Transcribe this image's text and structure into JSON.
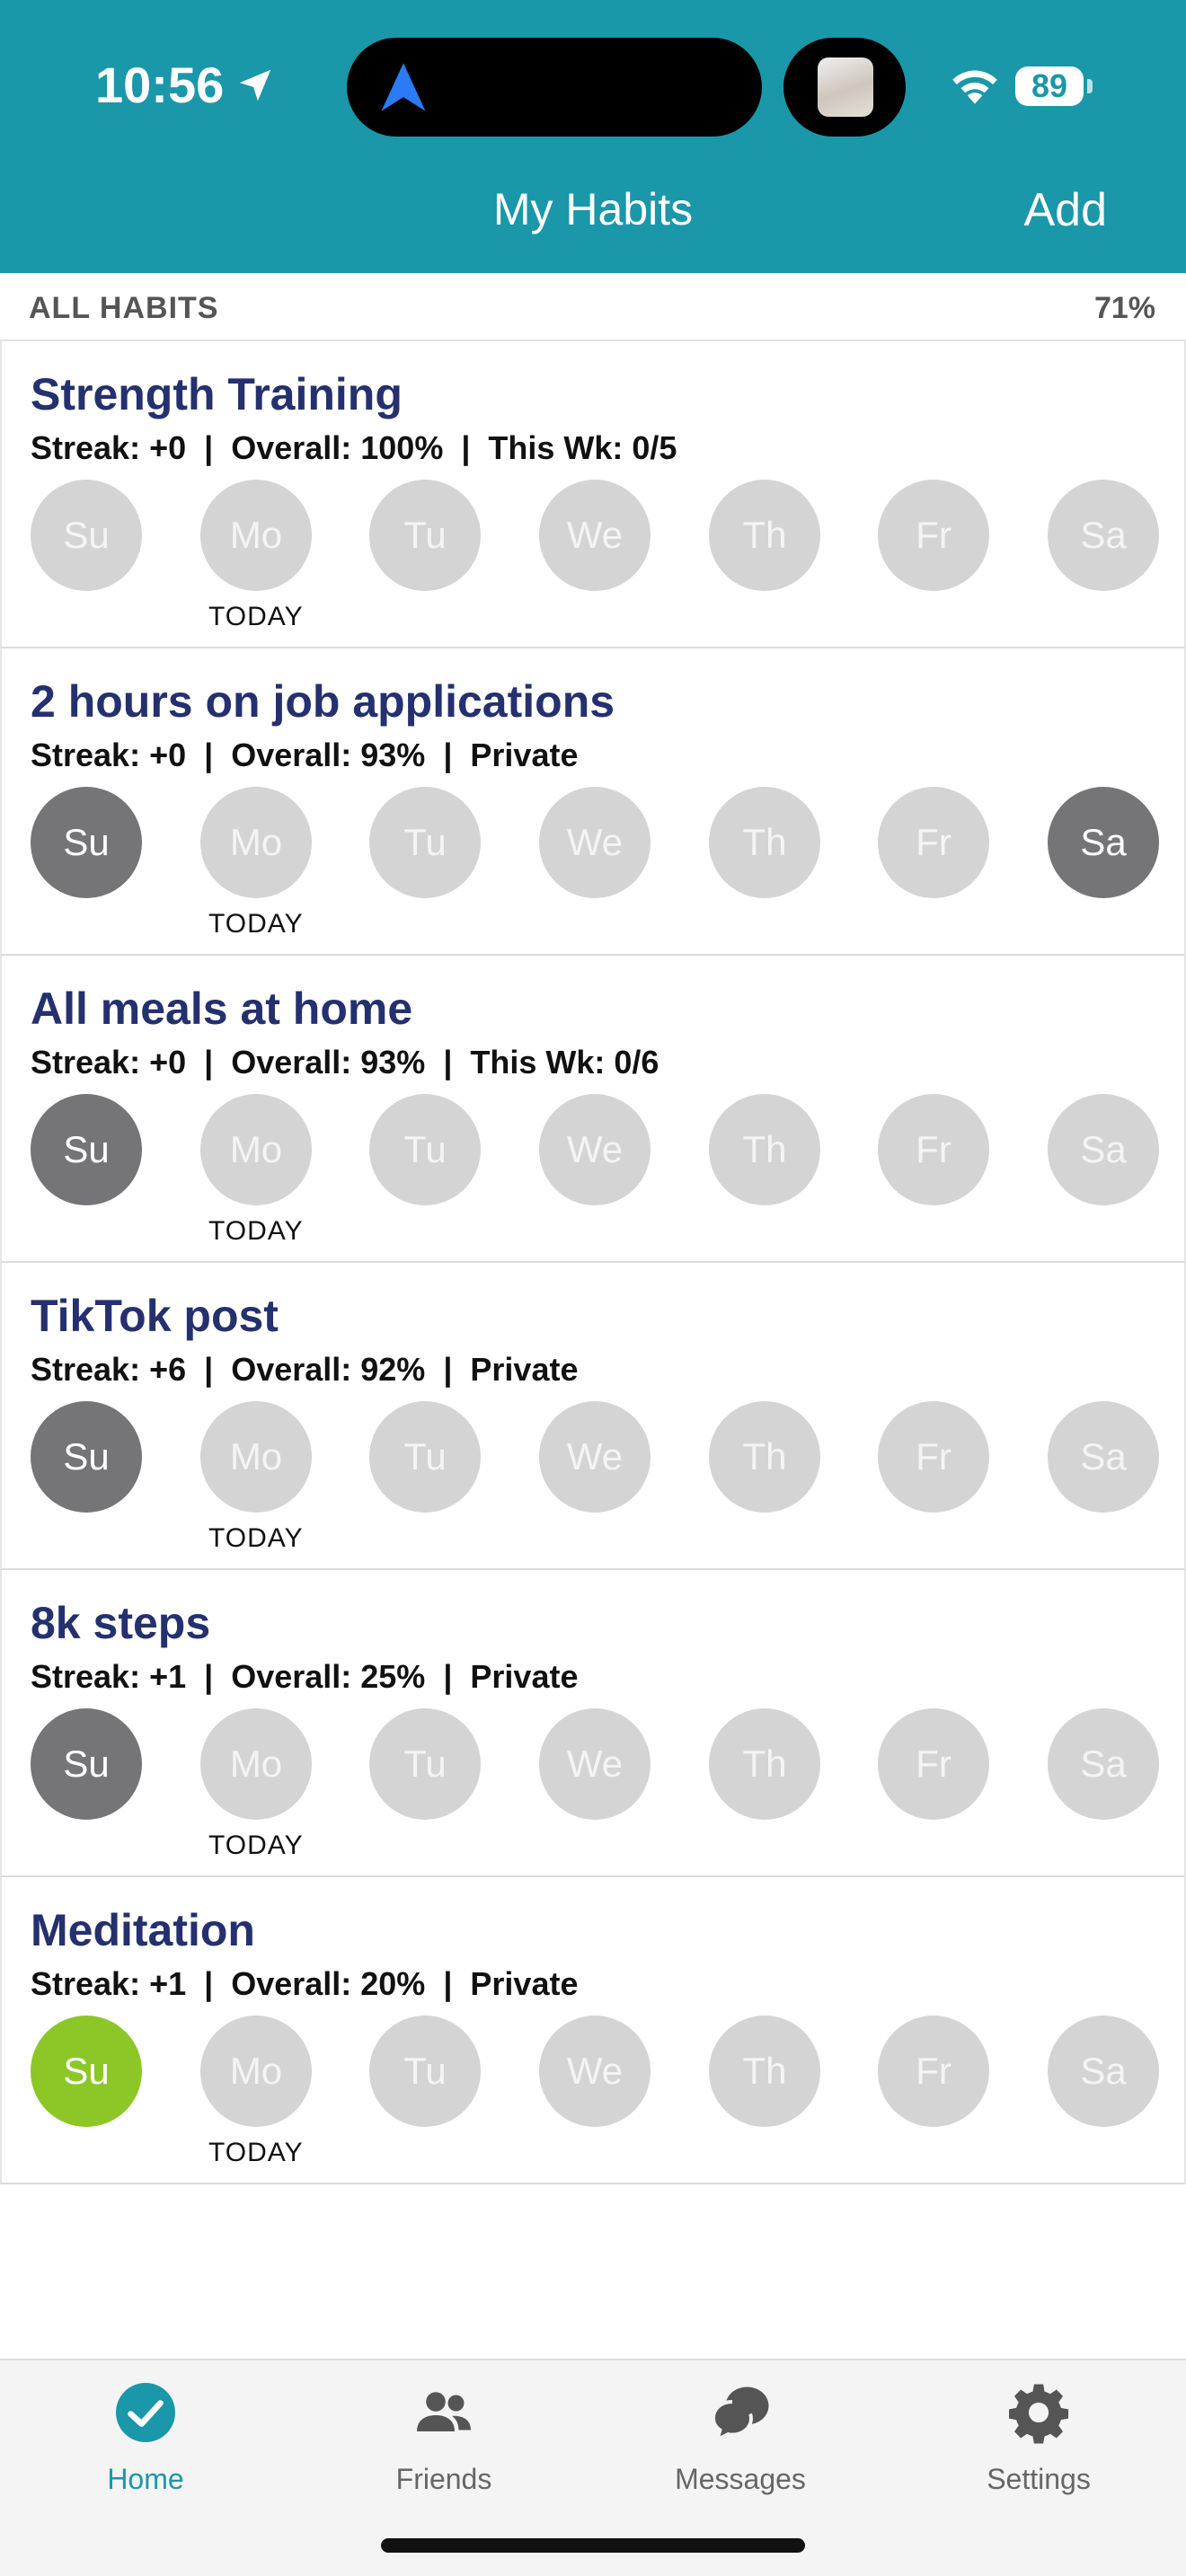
{
  "status": {
    "time": "10:56",
    "battery": "89"
  },
  "header": {
    "title": "My Habits",
    "add_label": "Add"
  },
  "section": {
    "label": "ALL HABITS",
    "percent": "71%"
  },
  "colors": {
    "accent": "#1b97aa",
    "title": "#25306e",
    "done": "#757577",
    "green": "#8cc727",
    "empty": "#d4d4d4"
  },
  "today_label": "TODAY",
  "habits": [
    {
      "name": "Strength Training",
      "stats": "Streak: +0  |  Overall: 100%  |  This Wk: 0/5",
      "days": [
        {
          "label": "Su",
          "state": "empty"
        },
        {
          "label": "Mo",
          "state": "empty"
        },
        {
          "label": "Tu",
          "state": "empty"
        },
        {
          "label": "We",
          "state": "empty"
        },
        {
          "label": "Th",
          "state": "empty"
        },
        {
          "label": "Fr",
          "state": "empty"
        },
        {
          "label": "Sa",
          "state": "empty"
        }
      ]
    },
    {
      "name": "2 hours on job applications",
      "stats": "Streak: +0  |  Overall: 93%  |  Private",
      "days": [
        {
          "label": "Su",
          "state": "done"
        },
        {
          "label": "Mo",
          "state": "empty"
        },
        {
          "label": "Tu",
          "state": "empty"
        },
        {
          "label": "We",
          "state": "empty"
        },
        {
          "label": "Th",
          "state": "empty"
        },
        {
          "label": "Fr",
          "state": "empty"
        },
        {
          "label": "Sa",
          "state": "done"
        }
      ]
    },
    {
      "name": "All meals at home",
      "stats": "Streak: +0  |  Overall: 93%  |  This Wk: 0/6",
      "days": [
        {
          "label": "Su",
          "state": "done"
        },
        {
          "label": "Mo",
          "state": "empty"
        },
        {
          "label": "Tu",
          "state": "empty"
        },
        {
          "label": "We",
          "state": "empty"
        },
        {
          "label": "Th",
          "state": "empty"
        },
        {
          "label": "Fr",
          "state": "empty"
        },
        {
          "label": "Sa",
          "state": "empty"
        }
      ]
    },
    {
      "name": "TikTok post",
      "stats": "Streak: +6  |  Overall: 92%  |  Private",
      "days": [
        {
          "label": "Su",
          "state": "done"
        },
        {
          "label": "Mo",
          "state": "empty"
        },
        {
          "label": "Tu",
          "state": "empty"
        },
        {
          "label": "We",
          "state": "empty"
        },
        {
          "label": "Th",
          "state": "empty"
        },
        {
          "label": "Fr",
          "state": "empty"
        },
        {
          "label": "Sa",
          "state": "empty"
        }
      ]
    },
    {
      "name": "8k steps",
      "stats": "Streak: +1  |  Overall: 25%  |  Private",
      "days": [
        {
          "label": "Su",
          "state": "done"
        },
        {
          "label": "Mo",
          "state": "empty"
        },
        {
          "label": "Tu",
          "state": "empty"
        },
        {
          "label": "We",
          "state": "empty"
        },
        {
          "label": "Th",
          "state": "empty"
        },
        {
          "label": "Fr",
          "state": "empty"
        },
        {
          "label": "Sa",
          "state": "empty"
        }
      ]
    },
    {
      "name": "Meditation",
      "stats": "Streak: +1  |  Overall: 20%  |  Private",
      "days": [
        {
          "label": "Su",
          "state": "green"
        },
        {
          "label": "Mo",
          "state": "empty"
        },
        {
          "label": "Tu",
          "state": "empty"
        },
        {
          "label": "We",
          "state": "empty"
        },
        {
          "label": "Th",
          "state": "empty"
        },
        {
          "label": "Fr",
          "state": "empty"
        },
        {
          "label": "Sa",
          "state": "empty"
        }
      ]
    }
  ],
  "tabs": [
    {
      "label": "Home",
      "icon": "check-circle-icon",
      "active": true
    },
    {
      "label": "Friends",
      "icon": "people-icon",
      "active": false
    },
    {
      "label": "Messages",
      "icon": "chat-bubbles-icon",
      "active": false
    },
    {
      "label": "Settings",
      "icon": "gear-icon",
      "active": false
    }
  ]
}
